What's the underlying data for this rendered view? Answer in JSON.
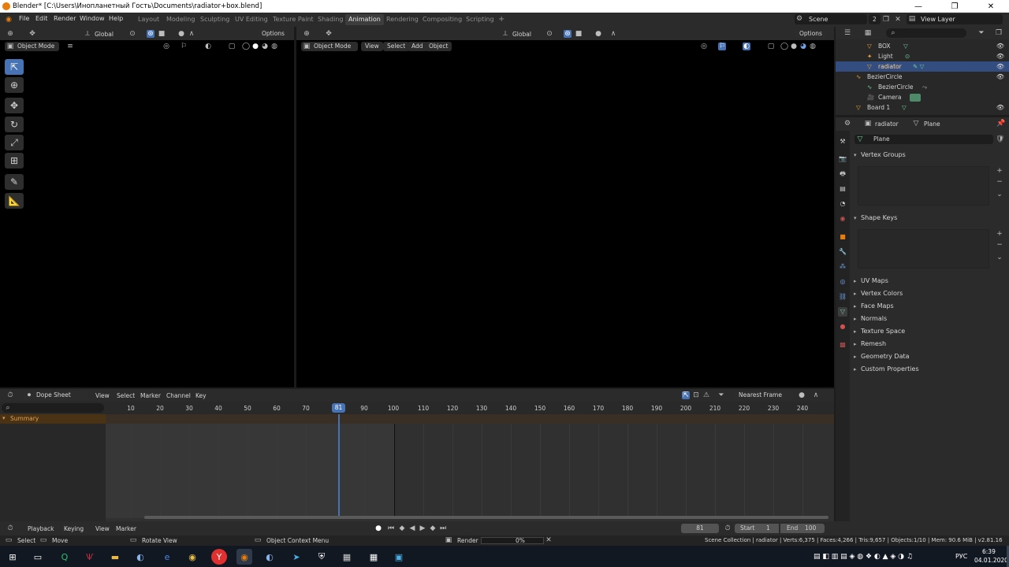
{
  "window": {
    "title": "Blender* [C:\\Users\\Инопланетный Гость\\Documents\\radiator+box.blend]",
    "minimize": "—",
    "maximize": "❐",
    "close": "✕"
  },
  "menu": [
    "File",
    "Edit",
    "Render",
    "Window",
    "Help"
  ],
  "workspaces": [
    "Layout",
    "Modeling",
    "Sculpting",
    "UV Editing",
    "Texture Paint",
    "Shading",
    "Animation",
    "Rendering",
    "Compositing",
    "Scripting"
  ],
  "active_workspace": "Animation",
  "add_workspace": "+",
  "scene": {
    "label": "Scene",
    "count": "2"
  },
  "view_layer": "View Layer",
  "viewport_left": {
    "orientation": "Global",
    "options": "Options",
    "mode": "Object Mode"
  },
  "viewport_right": {
    "orientation": "Global",
    "options": "Options",
    "mode": "Object Mode",
    "menus": [
      "View",
      "Select",
      "Add",
      "Object"
    ]
  },
  "outliner": {
    "items": [
      {
        "name": "BOX",
        "depth": 1,
        "selected": false
      },
      {
        "name": "Light",
        "depth": 1,
        "selected": false
      },
      {
        "name": "radiator",
        "depth": 1,
        "selected": true
      },
      {
        "name": "BezierCircle",
        "depth": 0,
        "selected": false
      },
      {
        "name": "BezierCircle",
        "depth": 1,
        "selected": false
      },
      {
        "name": "Camera",
        "depth": 1,
        "selected": false
      },
      {
        "name": "Board 1",
        "depth": 0,
        "selected": false
      }
    ]
  },
  "properties": {
    "object": "radiator",
    "data": "Plane",
    "mesh_name": "Plane",
    "panels": [
      "Vertex Groups",
      "Shape Keys",
      "UV Maps",
      "Vertex Colors",
      "Face Maps",
      "Normals",
      "Texture Space",
      "Remesh",
      "Geometry Data",
      "Custom Properties"
    ],
    "add": "+",
    "remove": "−",
    "more": "⌄"
  },
  "dopesheet": {
    "editor": "Dope Sheet",
    "menus": [
      "View",
      "Select",
      "Marker",
      "Channel",
      "Key"
    ],
    "snap": "Nearest Frame",
    "summary": "Summary",
    "ticks": [
      "10",
      "20",
      "30",
      "40",
      "50",
      "60",
      "70",
      "90",
      "100",
      "110",
      "120",
      "130",
      "140",
      "150",
      "160",
      "170",
      "180",
      "190",
      "200",
      "210",
      "220",
      "230",
      "240"
    ],
    "current_frame": "81"
  },
  "timeline": {
    "menus": [
      "Playback",
      "Keying",
      "View",
      "Marker"
    ],
    "frame": "81",
    "start_label": "Start",
    "start": "1",
    "end_label": "End",
    "end": "100"
  },
  "status": {
    "select": "Select",
    "move": "Move",
    "rotate": "Rotate View",
    "context": "Object Context Menu",
    "render": "Render",
    "progress": "0%",
    "stats": "Scene Collection | radiator | Verts:6,375 | Faces:4,266 | Tris:9,657 | Objects:1/10 | Mem: 90.6 MiB | v2.81.16"
  },
  "taskbar": {
    "lang": "РУС",
    "time": "6:39",
    "date": "04.01.2020"
  },
  "colors": {
    "accent": "#4772b3",
    "orange": "#e87d0d",
    "selected_row": "#334d80",
    "playhead": "#4772b3"
  }
}
